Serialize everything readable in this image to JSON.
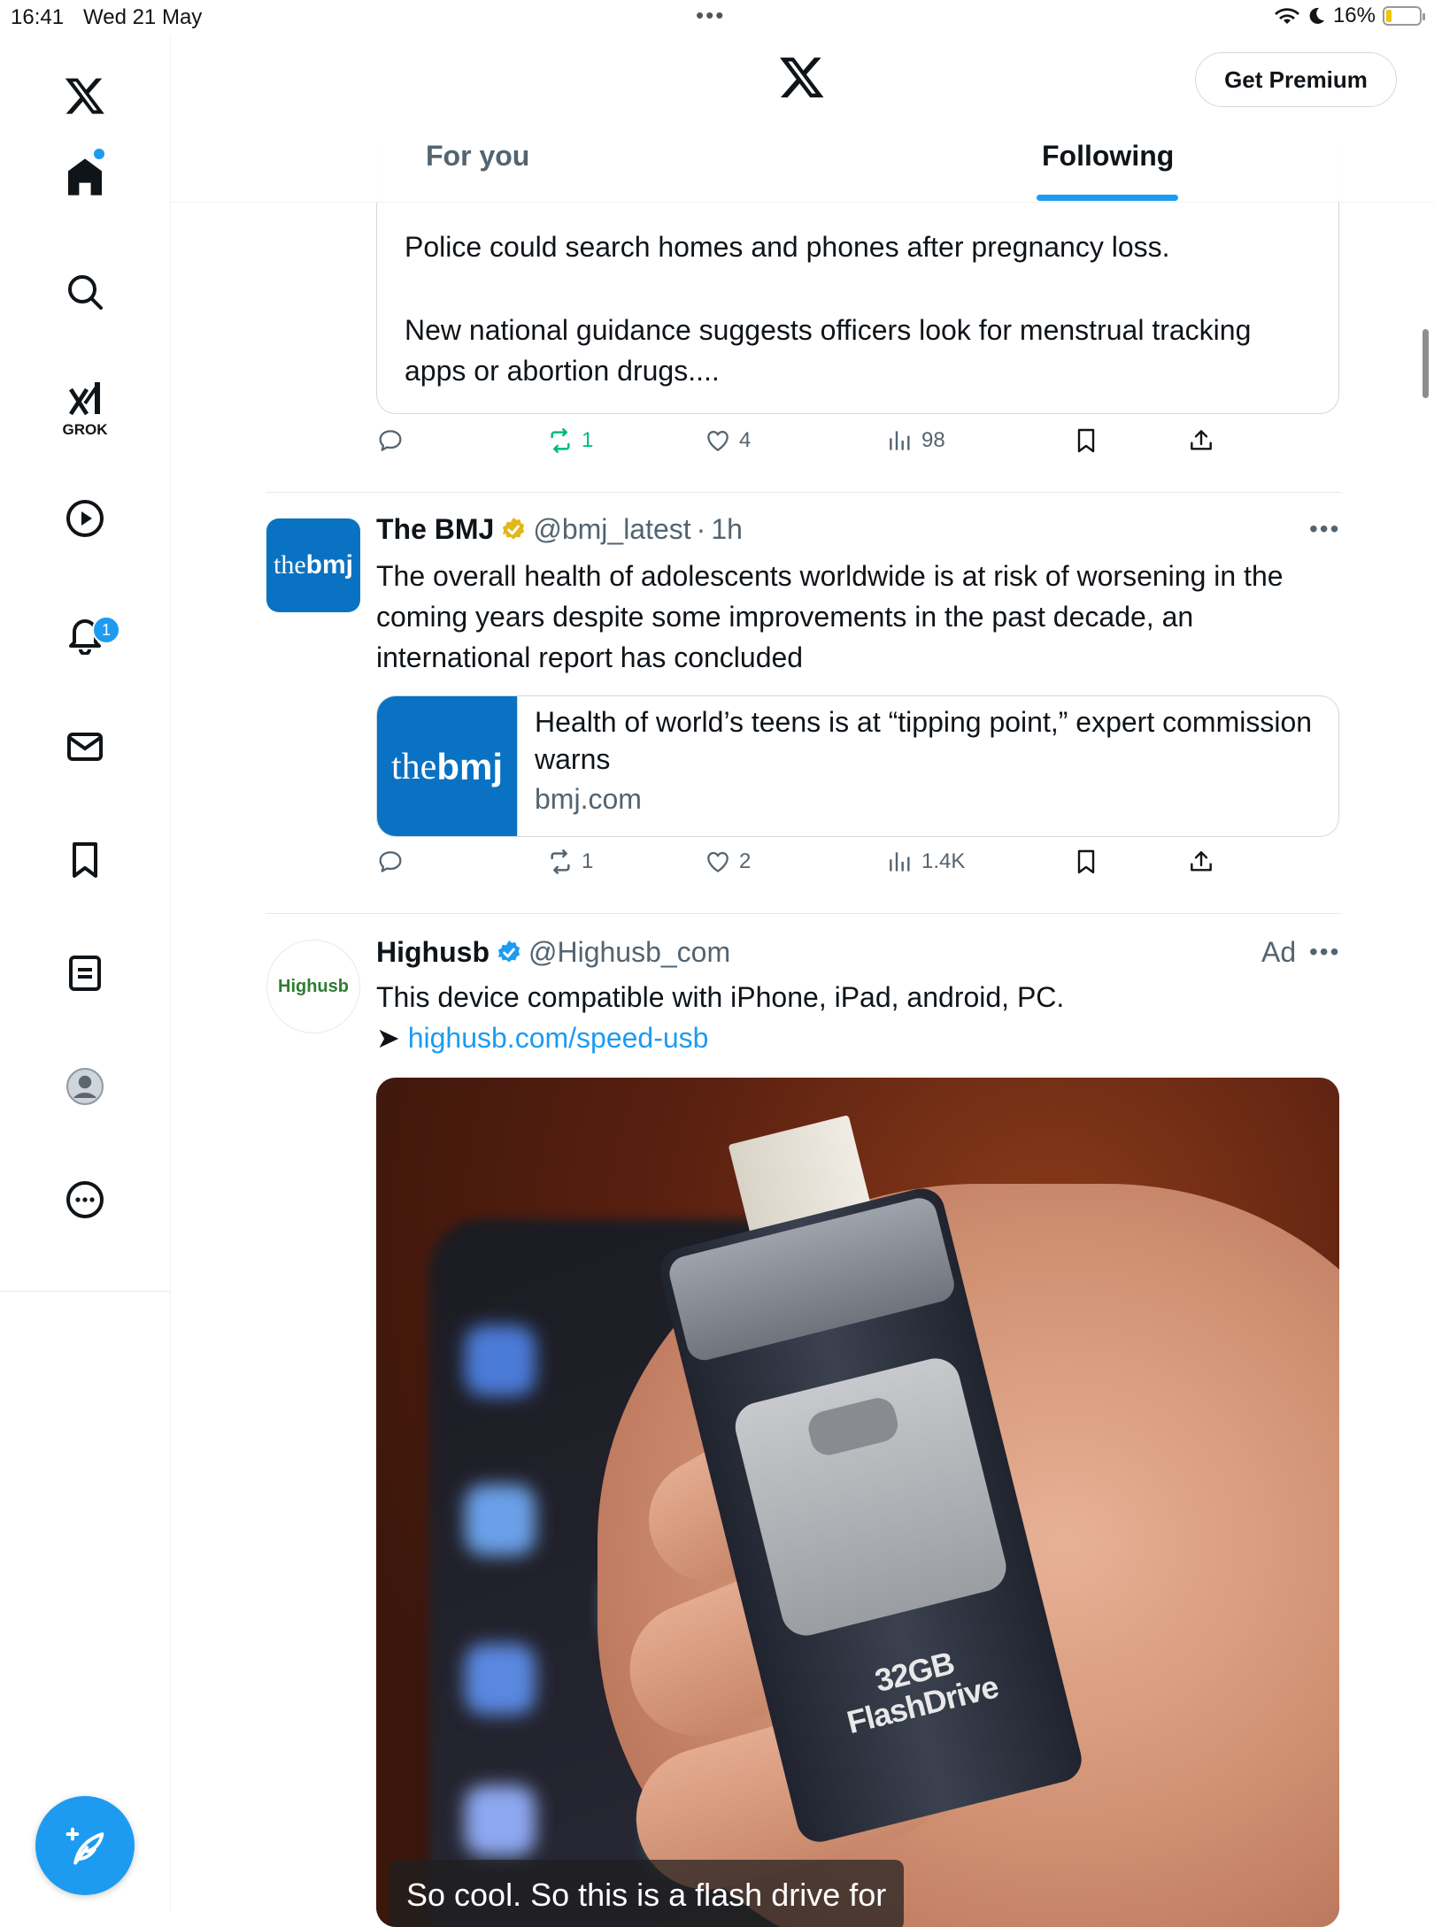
{
  "status_bar": {
    "time": "16:41",
    "date": "Wed 21 May",
    "battery": "16%",
    "battery_level": 0.16
  },
  "header": {
    "premium_button": "Get Premium",
    "tabs": [
      {
        "label": "For you"
      },
      {
        "label": "Following"
      }
    ],
    "active_tab": "Following"
  },
  "rail": {
    "grok_label": "GROK",
    "notifications_badge": "1"
  },
  "quoted_post": {
    "text_line_1": "Police could search homes and phones after pregnancy loss.",
    "text_line_2": "New national guidance suggests officers look for menstrual tracking apps or abortion drugs...."
  },
  "quote_actions": {
    "retweets": "1",
    "likes": "4",
    "views": "98"
  },
  "bmj_post": {
    "avatar_text_plain": "the",
    "avatar_text_bold": "bmj",
    "name": "The BMJ",
    "handle": "@bmj_latest",
    "time": "1h",
    "text": "The overall health of adolescents worldwide is at risk of worsening in the coming years despite some improvements in the past decade, an international report has concluded",
    "card": {
      "title": "Health of world’s teens is at “tipping point,” expert commission warns",
      "domain": "bmj.com"
    },
    "actions": {
      "retweets": "1",
      "likes": "2",
      "views": "1.4K"
    }
  },
  "ad_post": {
    "avatar_text": "Highusb",
    "name": "Highusb",
    "handle": "@Highusb_com",
    "ad_label": "Ad",
    "text": "This device compatible with iPhone, iPad, android, PC.",
    "link_prefix": "➤",
    "link": "highusb.com/speed-usb",
    "media_label": "32GB FlashDrive",
    "caption": "So cool. So this is a flash drive for"
  },
  "colors": {
    "accent": "#1d9bf0",
    "retweet_active": "#00ba7c",
    "bmj_blue": "#0a72c3",
    "verified_gold": "#e2b719"
  }
}
